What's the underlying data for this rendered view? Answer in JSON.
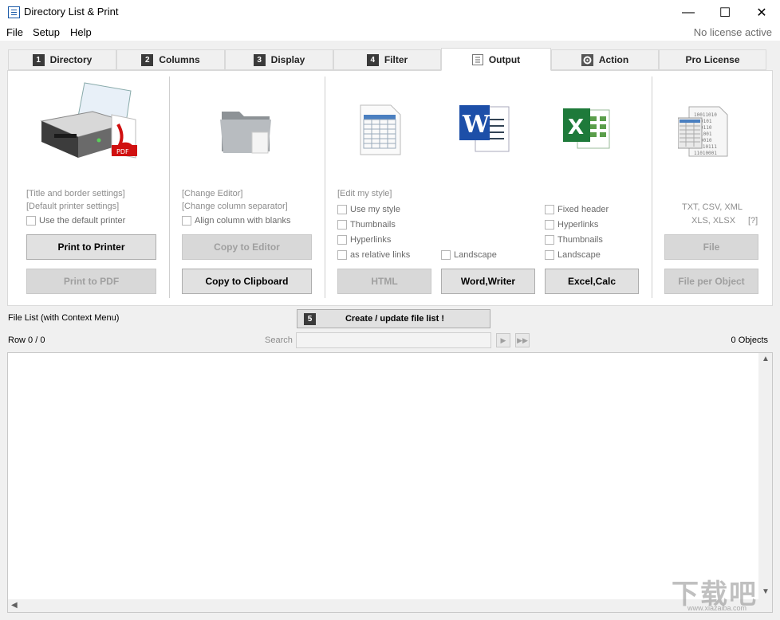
{
  "window": {
    "title": "Directory List & Print",
    "minimize": "—",
    "maximize": "☐",
    "close": "✕"
  },
  "menu": {
    "items": [
      "File",
      "Setup",
      "Help"
    ],
    "license_status": "No license active"
  },
  "tabs": [
    {
      "num": "1",
      "label": "Directory"
    },
    {
      "num": "2",
      "label": "Columns"
    },
    {
      "num": "3",
      "label": "Display"
    },
    {
      "num": "4",
      "label": "Filter"
    },
    {
      "label": "Output",
      "icon": "document-icon",
      "active": true
    },
    {
      "label": "Action",
      "icon": "gear-icon"
    },
    {
      "label": "Pro License"
    }
  ],
  "printer_section": {
    "icon": "printer-pdf-icon",
    "title_border_link": "[Title and border settings]",
    "printer_settings_link": "[Default printer settings]",
    "default_printer_checkbox": "Use the default printer",
    "print_button": "Print to Printer",
    "pdf_button": "Print to PDF"
  },
  "editor_section": {
    "icon": "folder-icon",
    "change_editor_link": "[Change Editor]",
    "change_separator_link": "[Change column separator]",
    "align_checkbox": "Align column with blanks",
    "copy_editor_button": "Copy to Editor",
    "copy_clipboard_button": "Copy to Clipboard"
  },
  "documents_section": {
    "edit_style_link": "[Edit my style]",
    "html_options": [
      "Use my style",
      "Thumbnails",
      "Hyperlinks",
      "as relative links"
    ],
    "word_landscape": "Landscape",
    "excel_options": [
      "Fixed header",
      "Hyperlinks",
      "Thumbnails",
      "Landscape"
    ],
    "html_button": "HTML",
    "word_button": "Word,Writer",
    "excel_button": "Excel,Calc",
    "icons": [
      "html-table-icon",
      "word-icon",
      "excel-icon"
    ]
  },
  "file_section": {
    "icon": "binary-file-icon",
    "formats_line1": "TXT, CSV, XML",
    "formats_line2": "XLS, XLSX",
    "help_link": "[?]",
    "file_button": "File",
    "file_per_object_button": "File per Object"
  },
  "file_list": {
    "label": "File List (with Context Menu)",
    "create_num": "5",
    "create_button": "Create / update file list !",
    "row_status": "Row 0 / 0",
    "search_label": "Search",
    "search_value": "",
    "objects_count": "0 Objects"
  },
  "watermark": {
    "text": "下载吧",
    "sub": "www.xiazaiba.com"
  }
}
